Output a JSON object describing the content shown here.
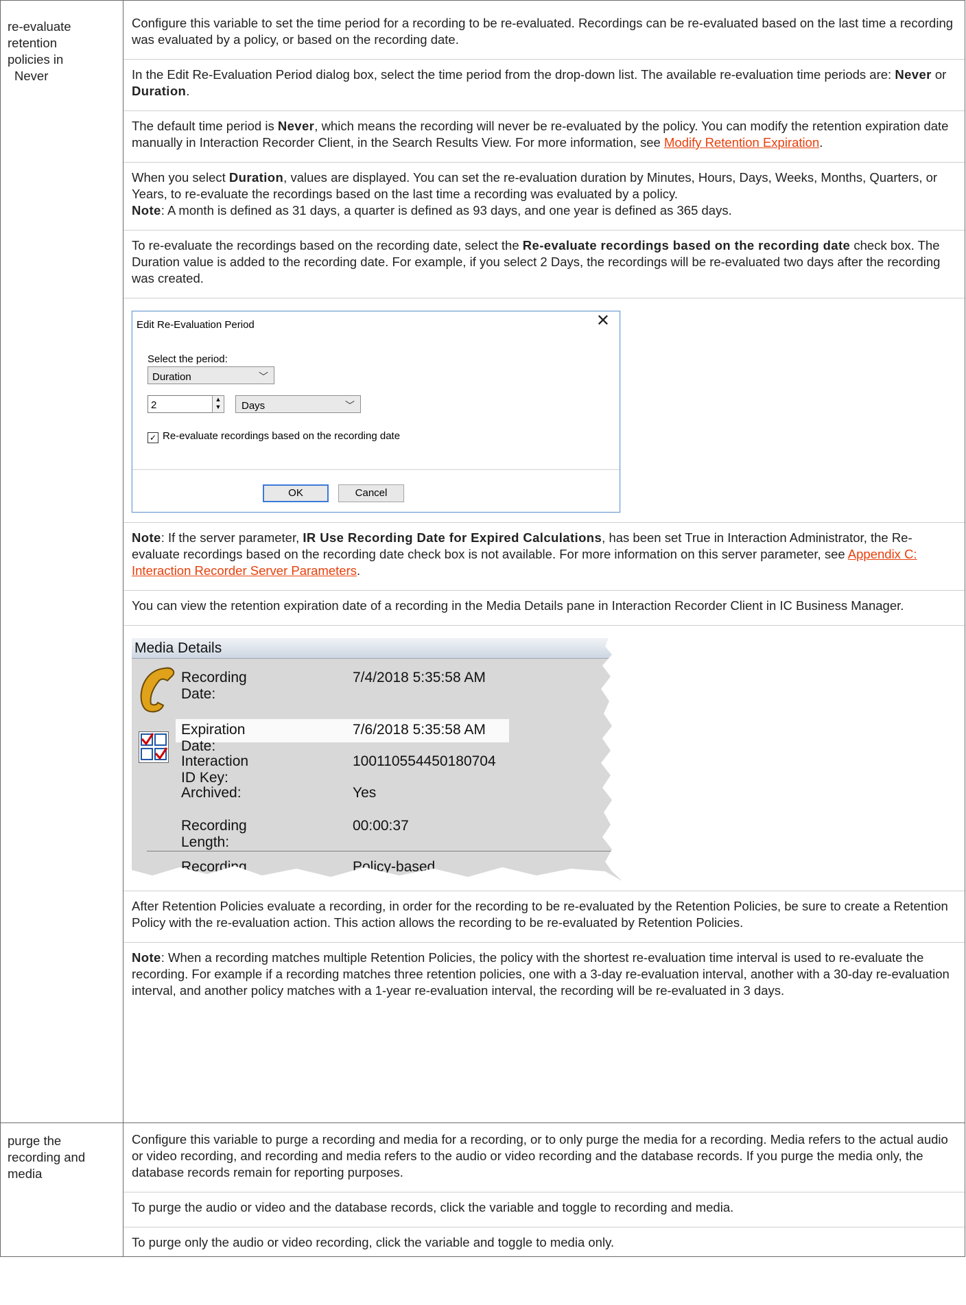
{
  "rows": [
    {
      "term": "re-evaluate retention policies in Never",
      "term_lines": [
        "re-evaluate",
        "retention",
        "policies in",
        "Never"
      ],
      "paragraphs": {
        "p1": "Configure this variable to set the time period for a recording to be re-evaluated. Recordings can be re-evaluated based on the last time a recording was evaluated by a policy, or based on the recording date.",
        "p2_a": "In the Edit Re-Evaluation Period dialog box, select the time period from the drop-down list. The available re-evaluation time periods are: ",
        "p2_b1": "Never",
        "p2_c": " or ",
        "p2_b2": "Duration",
        "p2_d": ".",
        "p3_a": "The default time period is ",
        "p3_b": "Never",
        "p3_c": ", which means the recording will never be re-evaluated by the policy. You can modify the retention expiration date manually in Interaction Recorder Client, in the Search Results View. For more information, see ",
        "p3_link": "Modify Retention Expiration",
        "p3_d": ".",
        "p4_a": "When you select ",
        "p4_b": "Duration",
        "p4_c": ", values are displayed. You can set the re-evaluation duration by Minutes, Hours, Days, Weeks, Months, Quarters, or Years, to re-evaluate the recordings based on the last time a recording was evaluated by a policy.",
        "p4_note": "Note",
        "p4_note_text": ":  A month is defined as 31 days, a quarter is defined as 93 days, and one year is defined as 365 days.",
        "p5_a": "To re-evaluate the recordings based on the recording date, select the ",
        "p5_b": "Re-evaluate recordings based on the recording date",
        "p5_c": " check box. The Duration value is added to the recording date. For example, if you select 2 Days, the recordings will be re-evaluated two days after the recording was created.",
        "p6_note": "Note",
        "p6_a": ": If the server parameter, ",
        "p6_b": "IR Use Recording Date for Expired Calculations",
        "p6_c": ", has been set True in Interaction Administrator, the Re-evaluate recordings based on the recording date check box is not available. For more information on this server parameter, see ",
        "p6_link": "Appendix C: Interaction Recorder Server Parameters",
        "p6_d": ".",
        "p7": "You can view the retention expiration date of a recording in the Media Details pane in Interaction Recorder Client in IC Business Manager.",
        "p8": "After Retention Policies evaluate a recording, in order for the recording to be re-evaluated by the Retention Policies, be sure to create a Retention Policy with the re-evaluation action. This action allows the recording to be re-evaluated by Retention Policies.",
        "p9_note": "Note",
        "p9_a": ": When a recording matches multiple Retention Policies, the policy with the shortest re-evaluation time interval is used to re-evaluate the recording. For example if a recording matches three retention policies, one with a 3-day re-evaluation interval, another with a 30-day re-evaluation interval, and another policy matches with a 1-year re-evaluation interval, the recording will be re-evaluated in 3 days."
      }
    },
    {
      "term_lines": [
        "purge the",
        "recording and",
        "media"
      ],
      "paragraphs": {
        "p1": "Configure this variable to purge a recording and media for a recording, or to only purge the media for a recording. Media refers to the actual audio or video recording, and recording and media refers to the audio or video recording and the database records. If you purge the media only, the database records remain for reporting purposes.",
        "p2": "To purge the audio or video and the database records, click the variable and toggle to recording and media.",
        "p3": "To purge only the audio or video recording, click the variable and toggle to media only."
      }
    }
  ],
  "dialog": {
    "title": "Edit Re-Evaluation Period",
    "close": "✕",
    "period_label": "Select the period:",
    "period_value": "Duration",
    "number_value": "2",
    "unit_value": "Days",
    "checkbox_label": "Re-evaluate recordings based on the recording date",
    "checkbox_checked": true,
    "ok": "OK",
    "cancel": "Cancel"
  },
  "media_details": {
    "header": "Media Details",
    "fields": [
      {
        "label": "Recording Date:",
        "value": "7/4/2018 5:35:58 AM"
      },
      {
        "label": "Expiration Date:",
        "value": "7/6/2018 5:35:58 AM"
      },
      {
        "label": "Interaction ID Key:",
        "value": "100110554450180704"
      },
      {
        "label": "Archived:",
        "value": "Yes"
      },
      {
        "label": "Recording Length:",
        "value": "00:00:37"
      },
      {
        "label": "Recording Type:",
        "value": "Policy-based"
      }
    ],
    "colors": {
      "header_top": "#f0f3f6",
      "header_bottom": "#cdd7e2",
      "panel": "#d8d8d8",
      "phone": "#e0a21a",
      "check": "#cc0000",
      "grid": "#1f57a6"
    }
  },
  "colors": {
    "link": "#e8400c",
    "dialog_border": "#6a9ad0",
    "ok_border": "#3b7ad6"
  }
}
